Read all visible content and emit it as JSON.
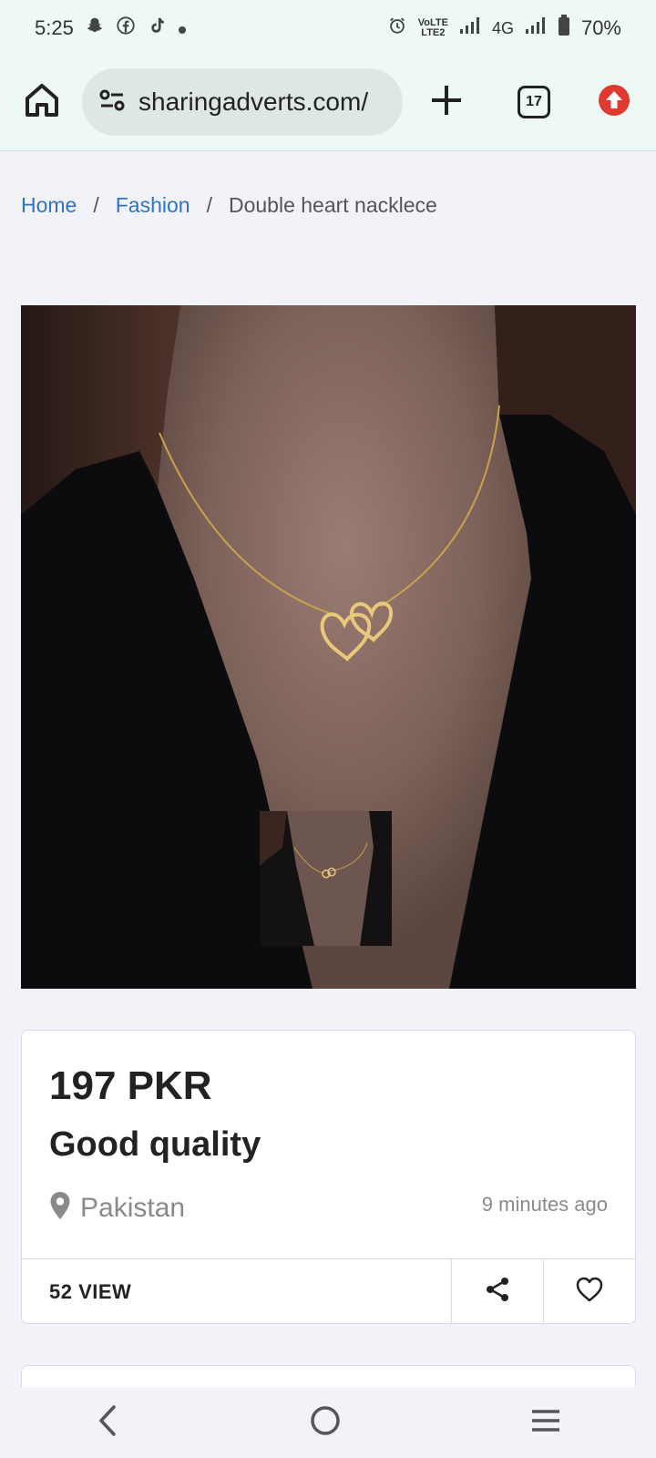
{
  "status_bar": {
    "time": "5:25",
    "network": "4G",
    "volte": "VoLTE",
    "lte2": "LTE2",
    "battery": "70%",
    "icons": [
      "snapchat-icon",
      "facebook-icon",
      "tiktok-icon",
      "dot-icon",
      "alarm-icon",
      "signal-icon",
      "battery-icon"
    ]
  },
  "browser": {
    "url": "sharingadverts.com/",
    "tab_count": "17"
  },
  "breadcrumb": {
    "home": "Home",
    "separator": "/",
    "category": "Fashion",
    "current": "Double heart nacklece"
  },
  "listing": {
    "price": "197 PKR",
    "title": "Good quality",
    "location": "Pakistan",
    "posted": "9 minutes ago",
    "views": "52 VIEW"
  },
  "colors": {
    "link": "#2f73c7",
    "update_badge": "#e0392f",
    "toolbar_bg": "#eef9f7",
    "page_bg": "#f2f3f8"
  }
}
